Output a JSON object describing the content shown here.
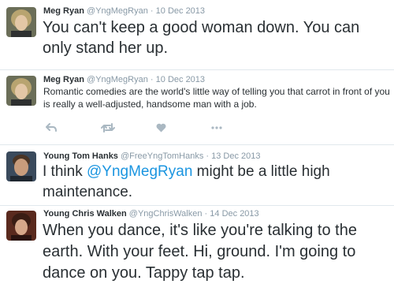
{
  "tweets": [
    {
      "name": "Meg Ryan",
      "handle": "@YngMegRyan",
      "sep": "·",
      "date": "10 Dec 2013",
      "text": "You can't keep a good woman down. You can only stand her up."
    },
    {
      "name": "Meg Ryan",
      "handle": "@YngMegRyan",
      "sep": "·",
      "date": "10 Dec 2013",
      "text": "Romantic comedies are the world's little way of telling you that carrot in front of you is really a well-adjusted, handsome man with a job."
    },
    {
      "name": "Young Tom Hanks",
      "handle": "@FreeYngTomHanks",
      "sep": "·",
      "date": "13 Dec 2013",
      "text_before": "I think ",
      "mention": "@YngMegRyan",
      "text_after": " might be a little high maintenance."
    },
    {
      "name": "Young Chris Walken",
      "handle": "@YngChrisWalken",
      "sep": "·",
      "date": "14 Dec 2013",
      "text": "When you dance, it's like you're talking to the earth. With your feet. Hi, ground. I'm going to dance on you. Tappy tap tap."
    }
  ],
  "actions": {
    "icons": [
      "reply-icon",
      "retweet-icon",
      "favorite-icon",
      "more-icon"
    ],
    "color": "#aab8c2"
  },
  "colors": {
    "name": "#292f33",
    "meta": "#8899a6",
    "text": "#292f33",
    "mention": "#1b95e0",
    "divider": "#e1e8ed"
  }
}
